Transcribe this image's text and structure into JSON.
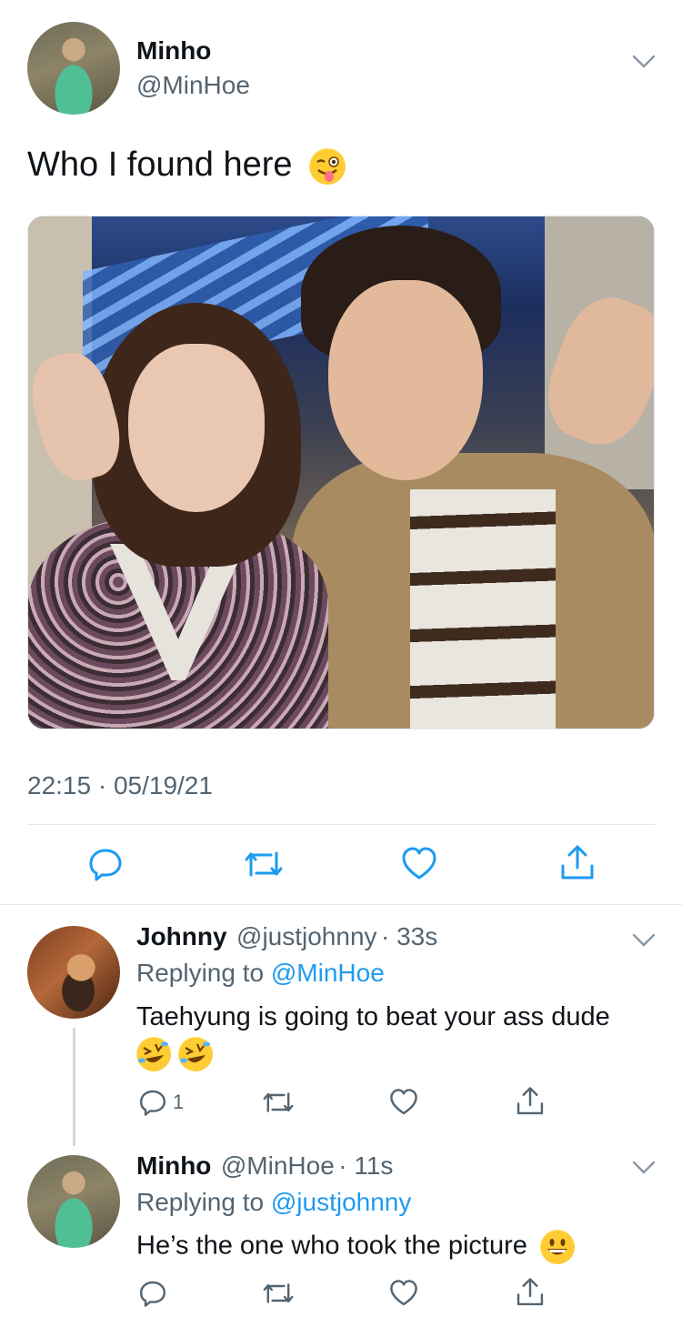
{
  "main_tweet": {
    "name": "Minho",
    "handle": "@MinHoe",
    "text": "Who I found here",
    "emoji": "😜",
    "timestamp": "22:15 · 05/19/21"
  },
  "replies": [
    {
      "name": "Johnny",
      "handle": "@justjohnny",
      "time": "· 33s",
      "replying_prefix": "Replying to",
      "replying_to": "@MinHoe",
      "text": "Taehyung is going to beat your ass dude",
      "emoji_line": "🤣🤣",
      "reply_count": "1"
    },
    {
      "name": "Minho",
      "handle": "@MinHoe",
      "time": "· 11s",
      "replying_prefix": "Replying to",
      "replying_to": "@justjohnny",
      "text": "He’s the one who took the picture",
      "emoji": "😀"
    }
  ],
  "colors": {
    "link": "#1d9bf0",
    "secondary": "#536471",
    "divider": "#e1e8ed"
  },
  "icons": [
    "reply-icon",
    "retweet-icon",
    "like-icon",
    "share-icon",
    "chevron-down-icon"
  ]
}
